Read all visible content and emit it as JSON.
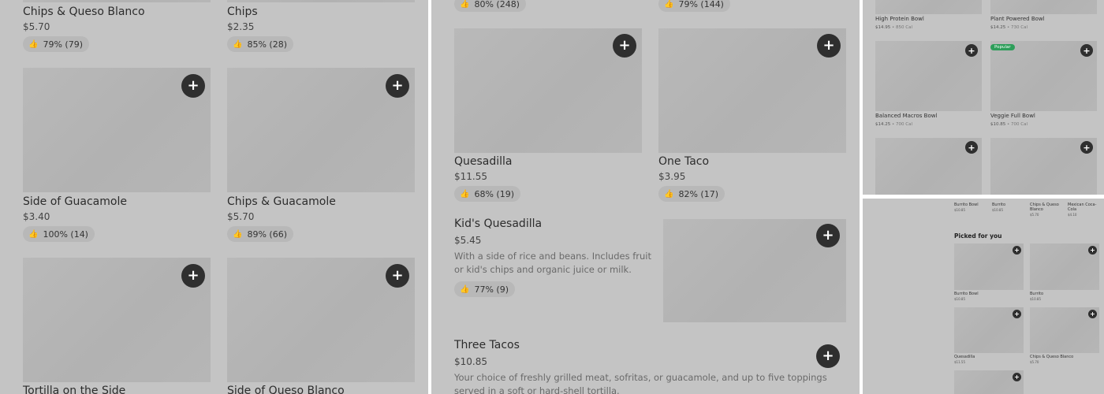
{
  "panel1": {
    "items": [
      {
        "name": "Chips & Queso Blanco",
        "price": "$5.70",
        "rating": "79% (79)"
      },
      {
        "name": "Chips",
        "price": "$2.35",
        "rating": "85% (28)"
      },
      {
        "name": "Side of Guacamole",
        "price": "$3.40",
        "rating": "100% (14)"
      },
      {
        "name": "Chips & Guacamole",
        "price": "$5.70",
        "rating": "89% (66)"
      },
      {
        "name": "Tortilla on the Side",
        "price": "",
        "rating": ""
      },
      {
        "name": "Side of Queso Blanco",
        "price": "",
        "rating": ""
      }
    ],
    "add_symbol": "+"
  },
  "panel2": {
    "top_ratings": [
      "80% (248)",
      "79% (144)"
    ],
    "items": [
      {
        "name": "Quesadilla",
        "price": "$11.55",
        "rating": "68% (19)"
      },
      {
        "name": "One Taco",
        "price": "$3.95",
        "rating": "82% (17)"
      },
      {
        "name": "Kid's Quesadilla",
        "price": "$5.45",
        "description": "With a side of rice and beans. Includes fruit or kid's chips and organic juice or milk.",
        "rating": "77% (9)"
      },
      {
        "name": "Three Tacos",
        "price": "$10.85",
        "description": "Your choice of freshly grilled meat, sofritas, or guacamole, and up to five toppings served in a soft or hard-shell tortilla."
      }
    ]
  },
  "panel3": {
    "items": [
      {
        "name": "High Protein Bowl",
        "price": "$14.95",
        "cal": "850 Cal"
      },
      {
        "name": "Plant Powered Bowl",
        "price": "$14.25",
        "cal": "730 Cal"
      },
      {
        "name": "Balanced Macros Bowl",
        "price": "$14.25",
        "cal": "700 Cal"
      },
      {
        "name": "Veggie Full Bowl",
        "price": "$10.85",
        "cal": "700 Cal",
        "badge": "Popular"
      }
    ],
    "separator": " • "
  },
  "panel4": {
    "top_row": [
      {
        "name": "Burrito Bowl",
        "price": "$10.85"
      },
      {
        "name": "Burrito",
        "price": "$10.85"
      },
      {
        "name": "Chips & Queso Blanco",
        "price": "$5.70"
      },
      {
        "name": "Mexican Coca-Cola",
        "price": "$4.10"
      }
    ],
    "section_title": "Picked for you",
    "items": [
      {
        "name": "Burrito Bowl",
        "price": "$10.85"
      },
      {
        "name": "Burrito",
        "price": "$10.85"
      },
      {
        "name": "Quesadilla",
        "price": "$11.55"
      },
      {
        "name": "Chips & Queso Blanco",
        "price": "$5.70"
      }
    ]
  },
  "icons": {
    "thumb": "thumbs-up-icon",
    "add": "plus-icon"
  },
  "colors": {
    "overlay": "#c4c4c4",
    "button": "#2f2f2f",
    "badge": "#2e9e5a"
  }
}
